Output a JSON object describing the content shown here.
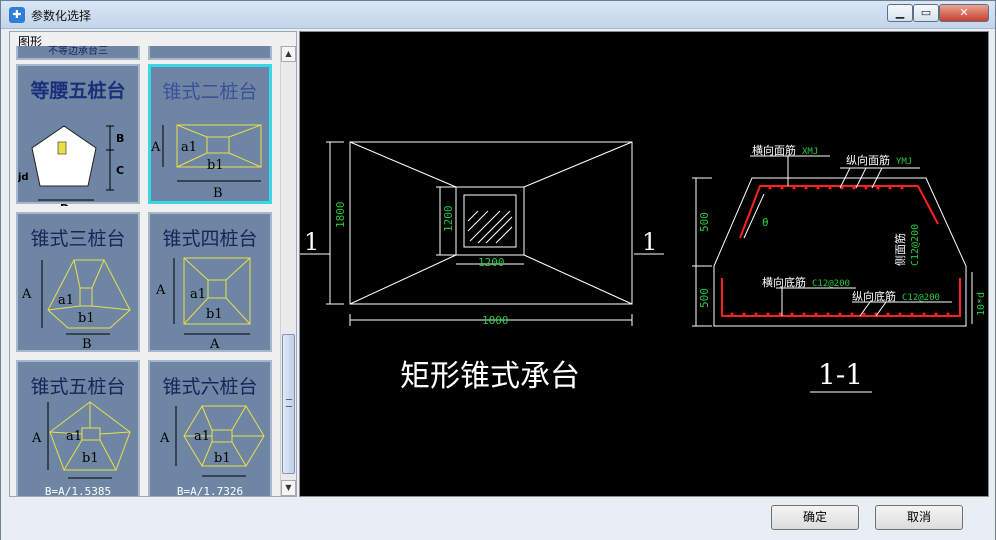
{
  "window": {
    "title": "参数化选择",
    "app_icon": "app-logo-icon"
  },
  "left_panel": {
    "label": "图形",
    "partial_caption": "不等边承台三",
    "thumbs": [
      {
        "caption": "等腰五桩台",
        "labels": {
          "b": "B",
          "c": "C",
          "d": "D",
          "jd": "jd"
        }
      },
      {
        "caption": "锥式二桩台",
        "labels": {
          "a": "A",
          "a1": "a1",
          "b1": "b1",
          "b": "B"
        }
      },
      {
        "caption": "锥式三桩台",
        "labels": {
          "a": "A",
          "a1": "a1",
          "b1": "b1",
          "b": "B"
        }
      },
      {
        "caption": "锥式四桩台",
        "labels": {
          "a": "A",
          "a1": "a1",
          "b1": "b1",
          "b": "A"
        }
      },
      {
        "caption": "锥式五桩台",
        "labels": {
          "a": "A",
          "a1": "a1",
          "b1": "b1"
        },
        "formula": "B=A/1.5385"
      },
      {
        "caption": "锥式六桩台",
        "labels": {
          "a": "A",
          "a1": "a1",
          "b1": "b1"
        },
        "formula": "B=A/1.7326"
      }
    ]
  },
  "drawing": {
    "plan": {
      "title": "矩形锥式承台",
      "width": "1800",
      "height": "1800",
      "col_w": "1200",
      "col_h": "1200",
      "section_mark": "1"
    },
    "section": {
      "title": "1-1",
      "top_h": "500",
      "bot_h": "500",
      "cover": "10*d",
      "angle": "θ",
      "labels": {
        "top_x": "横向面筋",
        "top_x_code": "XMJ",
        "top_y": "纵向面筋",
        "top_y_code": "YMJ",
        "side": "侧面筋",
        "side_code": "C12@200",
        "bot_x": "横向底筋",
        "bot_x_code": "C12@200",
        "bot_y": "纵向底筋",
        "bot_y_code": "C12@200"
      }
    }
  },
  "buttons": {
    "ok": "确定",
    "cancel": "取消"
  },
  "colors": {
    "cad_white": "#ffffff",
    "cad_green": "#27c93f",
    "cad_red": "#ff2020",
    "thumb_line": "#e8e04a"
  }
}
